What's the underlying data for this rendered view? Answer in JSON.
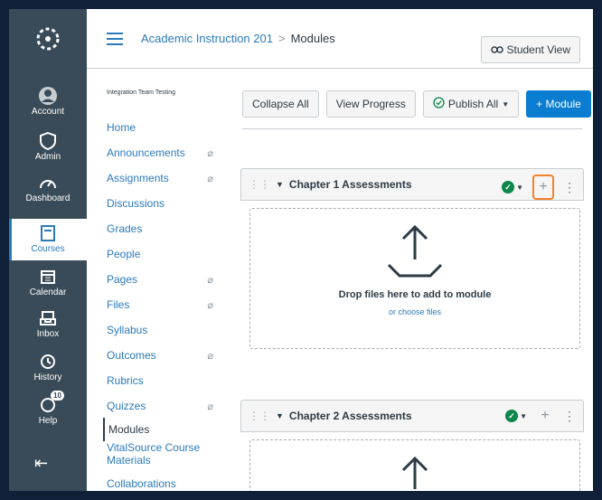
{
  "global_nav": {
    "items": [
      {
        "label": "Account",
        "icon": "user-icon"
      },
      {
        "label": "Admin",
        "icon": "shield-icon"
      },
      {
        "label": "Dashboard",
        "icon": "dashboard-icon"
      },
      {
        "label": "Courses",
        "icon": "book-icon",
        "active": true
      },
      {
        "label": "Calendar",
        "icon": "calendar-icon"
      },
      {
        "label": "Inbox",
        "icon": "inbox-icon"
      },
      {
        "label": "History",
        "icon": "clock-icon"
      },
      {
        "label": "Help",
        "icon": "help-icon",
        "badge": "10"
      }
    ]
  },
  "header": {
    "course": "Academic Instruction 201",
    "separator": ">",
    "page": "Modules",
    "student_view": "Student View"
  },
  "course_nav": {
    "subtitle": "Integration Team Testing",
    "items": [
      {
        "label": "Home"
      },
      {
        "label": "Announcements",
        "hidden": true
      },
      {
        "label": "Assignments",
        "hidden": true
      },
      {
        "label": "Discussions"
      },
      {
        "label": "Grades"
      },
      {
        "label": "People"
      },
      {
        "label": "Pages",
        "hidden": true
      },
      {
        "label": "Files",
        "hidden": true
      },
      {
        "label": "Syllabus"
      },
      {
        "label": "Outcomes",
        "hidden": true
      },
      {
        "label": "Rubrics"
      },
      {
        "label": "Quizzes",
        "hidden": true
      },
      {
        "label": "Modules",
        "active": true
      },
      {
        "label": "VitalSource Course Materials"
      },
      {
        "label": "Collaborations"
      }
    ]
  },
  "toolbar": {
    "collapse_all": "Collapse All",
    "view_progress": "View Progress",
    "publish_all": "Publish All",
    "add_module": "+ Module"
  },
  "modules": [
    {
      "title": "Chapter 1 Assessments",
      "drop_text": "Drop files here to add to module",
      "choose_link": "or choose files"
    },
    {
      "title": "Chapter 2 Assessments"
    }
  ],
  "colors": {
    "brand": "#0b7dd0",
    "nav_bg": "#394b58",
    "published": "#0b874b",
    "highlight": "#f5822a"
  }
}
